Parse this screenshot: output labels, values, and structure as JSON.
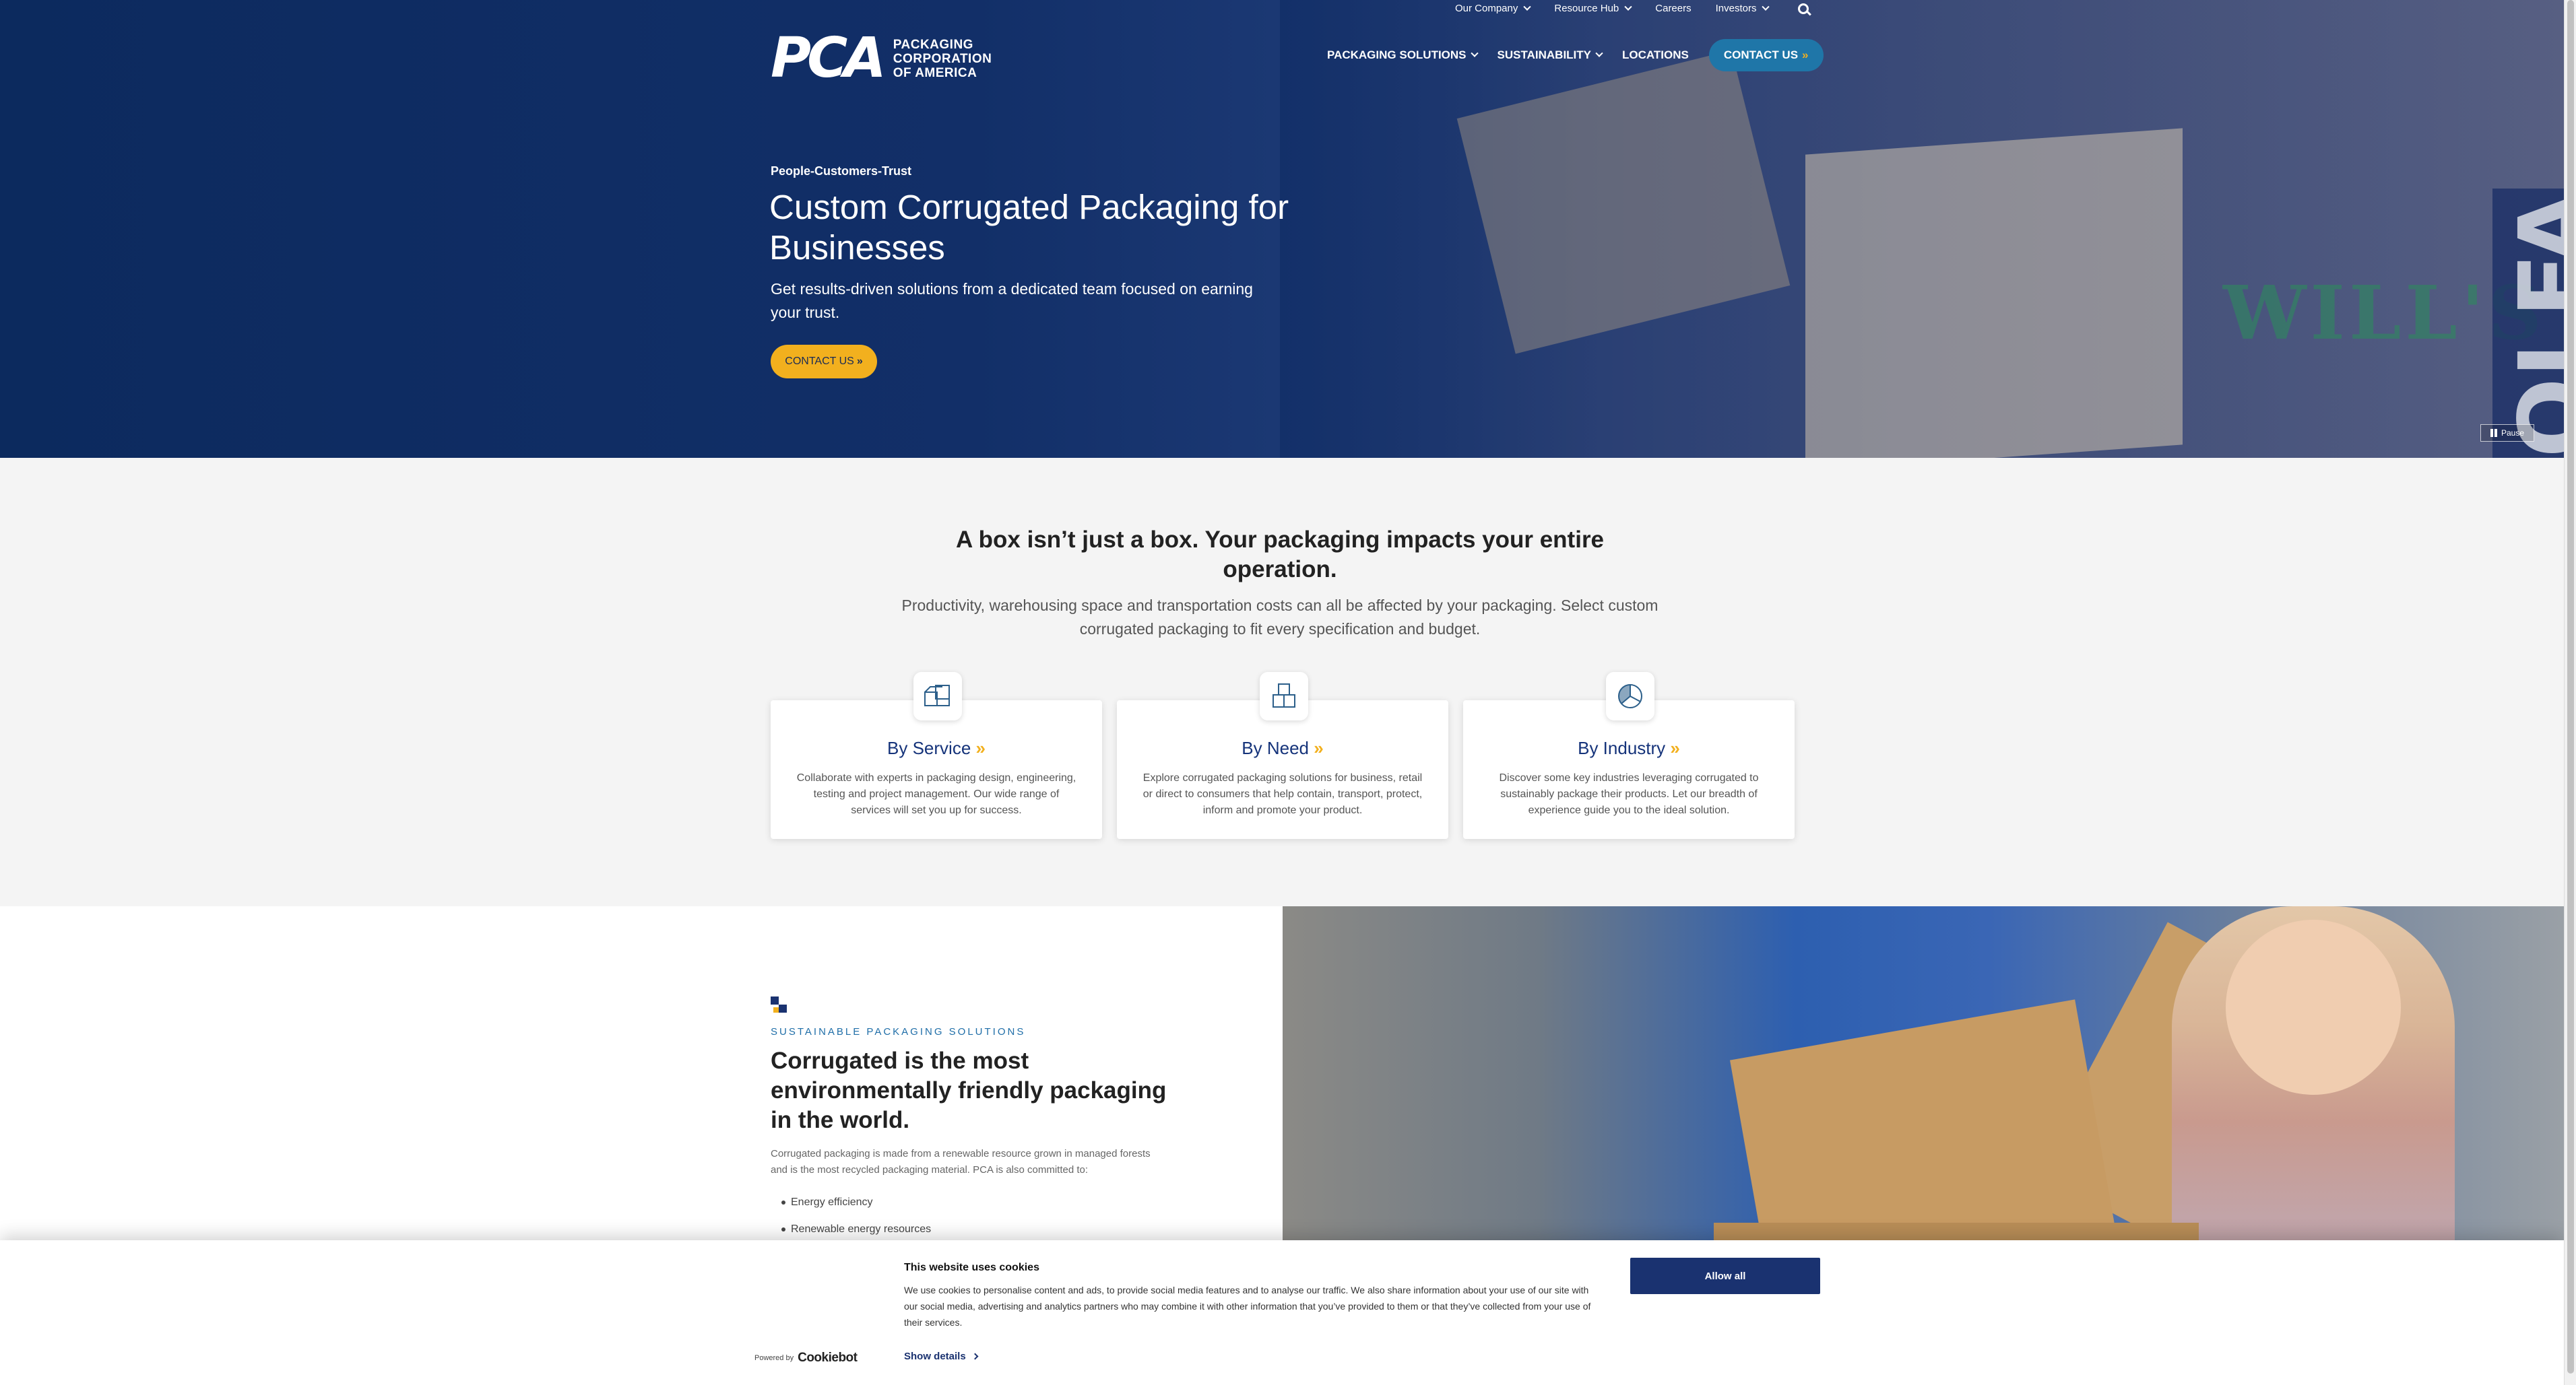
{
  "utility_nav": {
    "items": [
      {
        "label": "Our Company",
        "dropdown": true
      },
      {
        "label": "Resource Hub",
        "dropdown": true
      },
      {
        "label": "Careers",
        "dropdown": false
      },
      {
        "label": "Investors",
        "dropdown": true
      }
    ],
    "search_icon": "search-icon"
  },
  "logo": {
    "mark": "PCA",
    "line1": "PACKAGING",
    "line2": "CORPORATION",
    "line3": "OF AMERICA"
  },
  "main_nav": {
    "packaging_solutions": "PACKAGING SOLUTIONS",
    "sustainability": "SUSTAINABILITY",
    "locations": "LOCATIONS",
    "contact": "CONTACT US"
  },
  "hero": {
    "eyebrow": "People-Customers-Trust",
    "title": "Custom Corrugated Packaging for Businesses",
    "subtitle": "Get results-driven solutions from a dedicated team focused on earning your trust.",
    "cta": "CONTACT US",
    "pause": "Pause",
    "photo_text_1": "WILL'S",
    "photo_text_2": "OLFA"
  },
  "intro": {
    "title": "A box isn’t just a box. Your packaging impacts your entire operation.",
    "subtitle": "Productivity, warehousing space and transportation costs can all be affected by your packaging. Select custom corrugated packaging to fit every specification and budget."
  },
  "cards": [
    {
      "title": "By Service",
      "icon": "service-boxes-icon",
      "description": "Collaborate with experts in packaging design, engineering, testing and project management. Our wide range of services will set you up for success."
    },
    {
      "title": "By Need",
      "icon": "need-boxes-icon",
      "description": "Explore corrugated packaging solutions for business, retail or direct to consumers that help contain, transport, protect, inform and promote your product."
    },
    {
      "title": "By Industry",
      "icon": "industry-pie-icon",
      "description": "Discover some key industries leveraging corrugated to sustainably package their products. Let our breadth of experience guide you to the ideal solution."
    }
  ],
  "sustain": {
    "eyebrow": "SUSTAINABLE PACKAGING SOLUTIONS",
    "title": "Corrugated is the most environmentally friendly packaging in the world.",
    "body": "Corrugated packaging is made from a renewable resource grown in managed forests and is the most recycled packaging material. PCA is also committed to:",
    "list": [
      "Energy efficiency",
      "Renewable energy resources"
    ]
  },
  "cookie": {
    "title": "This website uses cookies",
    "text": "We use cookies to personalise content and ads, to provide social media features and to analyse our traffic. We also share information about your use of our site with our social media, advertising and analytics partners who may combine it with other information that you’ve provided to them or that they’ve collected from your use of their services.",
    "allow": "Allow all",
    "details": "Show details",
    "powered_by": "Powered by",
    "cookiebot": "Cookiebot"
  },
  "colors": {
    "navy": "#0c2a5e",
    "accent_yellow": "#f2b01e",
    "link_blue": "#15337a",
    "teal_button": "#1f76a8"
  }
}
